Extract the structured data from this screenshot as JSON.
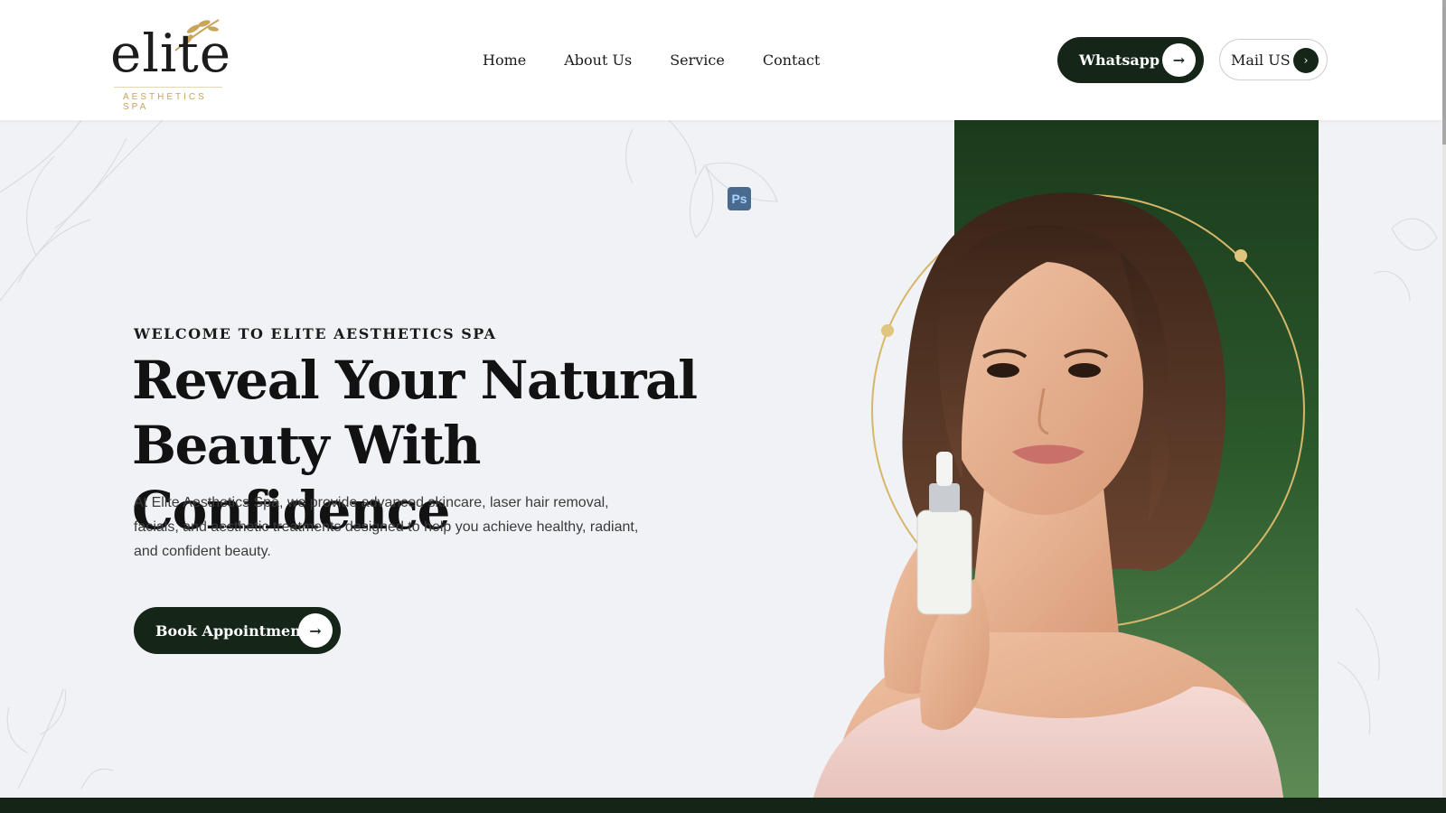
{
  "header": {
    "logo": {
      "word": "elite",
      "subtitle": "AESTHETICS SPA"
    },
    "nav": [
      {
        "label": "Home"
      },
      {
        "label": "About Us"
      },
      {
        "label": "Service"
      },
      {
        "label": "Contact"
      }
    ],
    "whatsapp_label": "Whatsapp",
    "mail_label": "Mail US"
  },
  "hero": {
    "eyebrow": "WELCOME TO ELITE AESTHETICS SPA",
    "headline_line1": "Reveal Your Natural",
    "headline_line2": "Beauty With Confidence",
    "description": "At Elite Aesthetics Spa, we provide advanced skincare, laser hair removal, facials, and aesthetic treatments designed to help you achieve healthy, radiant, and confident beauty.",
    "cta_label": "Book Appointment",
    "ps_badge": "Ps"
  },
  "colors": {
    "brand_dark": "#152619",
    "accent_gold": "#d6b76a",
    "panel_green": "#2c5a2c",
    "page_bg": "#f1f2f6"
  },
  "icons": {
    "whatsapp_arrow": "arrow-right-icon",
    "mail_chevron": "chevron-right-icon",
    "cta_arrow": "arrow-right-icon",
    "logo_leaf": "leaf-icon"
  }
}
